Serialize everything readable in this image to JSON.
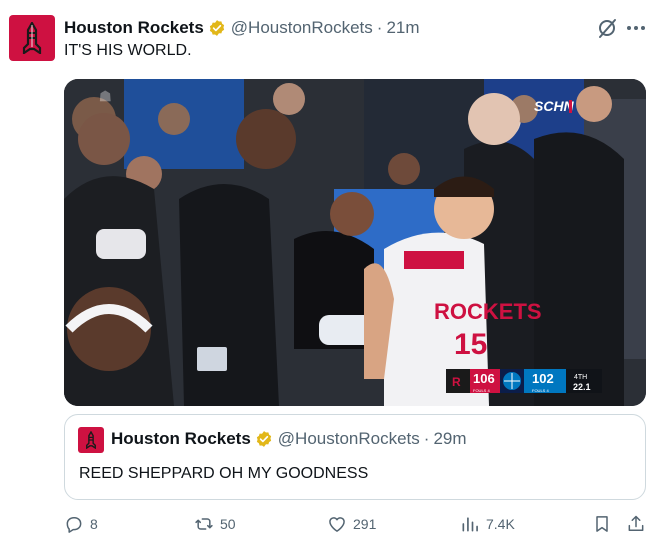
{
  "tweet": {
    "author_name": "Houston Rockets",
    "handle": "@HoustonRockets",
    "separator": "·",
    "time": "21m",
    "text": "IT'S HIS WORLD."
  },
  "media": {
    "watermark": "SCHN",
    "jersey_team": "ROCKETS",
    "jersey_number": "15",
    "scorebug": {
      "home_score": "106",
      "home_fouls": "FOULS 4",
      "away_score": "102",
      "away_fouls": "FOULS 4",
      "period": "4TH",
      "clock": "22.1"
    }
  },
  "quote": {
    "author_name": "Houston Rockets",
    "handle": "@HoustonRockets",
    "separator": "·",
    "time": "29m",
    "text": "REED SHEPPARD OH MY GOODNESS"
  },
  "actions": {
    "replies": "8",
    "reposts": "50",
    "likes": "291",
    "views": "7.4K"
  },
  "colors": {
    "rockets_red": "#ce1141",
    "magic_blue": "#0077c0",
    "verified_gold": "#e2b719",
    "muted_text": "#536471"
  },
  "icons": [
    "rockets-logo-icon",
    "verified-badge-icon",
    "grok-icon",
    "more-icon",
    "reply-icon",
    "retweet-icon",
    "like-icon",
    "views-icon",
    "bookmark-icon",
    "share-icon"
  ]
}
